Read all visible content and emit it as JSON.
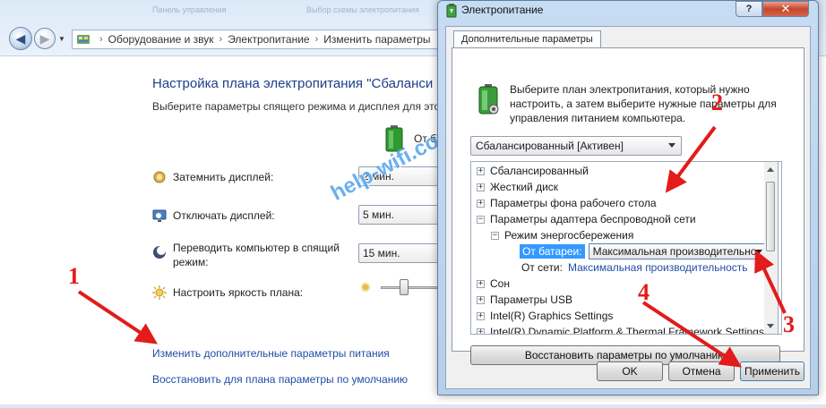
{
  "background": {
    "faded_text_1": "Панель управления",
    "faded_text_2": "Выбор схемы электропитания",
    "breadcrumb": [
      "Оборудование и звук",
      "Электропитание",
      "Изменить параметры"
    ],
    "title": "Настройка плана электропитания \"Сбаланси",
    "subtitle": "Выберите параметры спящего режима и дисплея для это",
    "power_column_header": "От ба",
    "rows": [
      {
        "label": "Затемнить дисплей:",
        "value": "2 мин."
      },
      {
        "label": "Отключать дисплей:",
        "value": "5 мин."
      },
      {
        "label_line1": "Переводить компьютер в спящий",
        "label_line2": "режим:",
        "value": "15 мин."
      },
      {
        "label": "Настроить яркость плана:"
      }
    ],
    "links": {
      "advanced": "Изменить дополнительные параметры питания",
      "restore": "Восстановить для плана параметры по умолчанию"
    }
  },
  "watermark": "help-wifi.com",
  "dialog": {
    "title": "Электропитание",
    "help_glyph": "?",
    "close_glyph": "✕",
    "tab_label": "Дополнительные параметры",
    "description": "Выберите план электропитания, который нужно настроить, а затем выберите нужные параметры для управления питанием компьютера.",
    "plan_selected": "Сбалансированный [Активен]",
    "tree": {
      "item_balanced": "Сбалансированный",
      "item_hdd": "Жесткий диск",
      "item_desktop": "Параметры фона рабочего стола",
      "item_wireless": "Параметры адаптера беспроводной сети",
      "item_powersave": "Режим энергосбережения",
      "on_battery_label": "От батареи:",
      "on_battery_value": "Максимальная производительно",
      "on_ac_label": "От сети:",
      "on_ac_value": "Максимальная производительность",
      "item_sleep": "Сон",
      "item_usb": "Параметры USB",
      "item_intel_graphics": "Intel(R) Graphics Settings",
      "item_intel_dptf": "Intel(R) Dynamic Platform & Thermal Framework Settings"
    },
    "restore_button": "Восстановить параметры по умолчанию",
    "ok_button": "OK",
    "cancel_button": "Отмена",
    "apply_button": "Применить"
  },
  "annotations": {
    "n1": "1",
    "n2": "2",
    "n3": "3",
    "n4": "4"
  },
  "colors": {
    "arrow": "#e31b1b",
    "link": "#1f4ea5",
    "title": "#1d3f86",
    "selection": "#3399ff"
  }
}
